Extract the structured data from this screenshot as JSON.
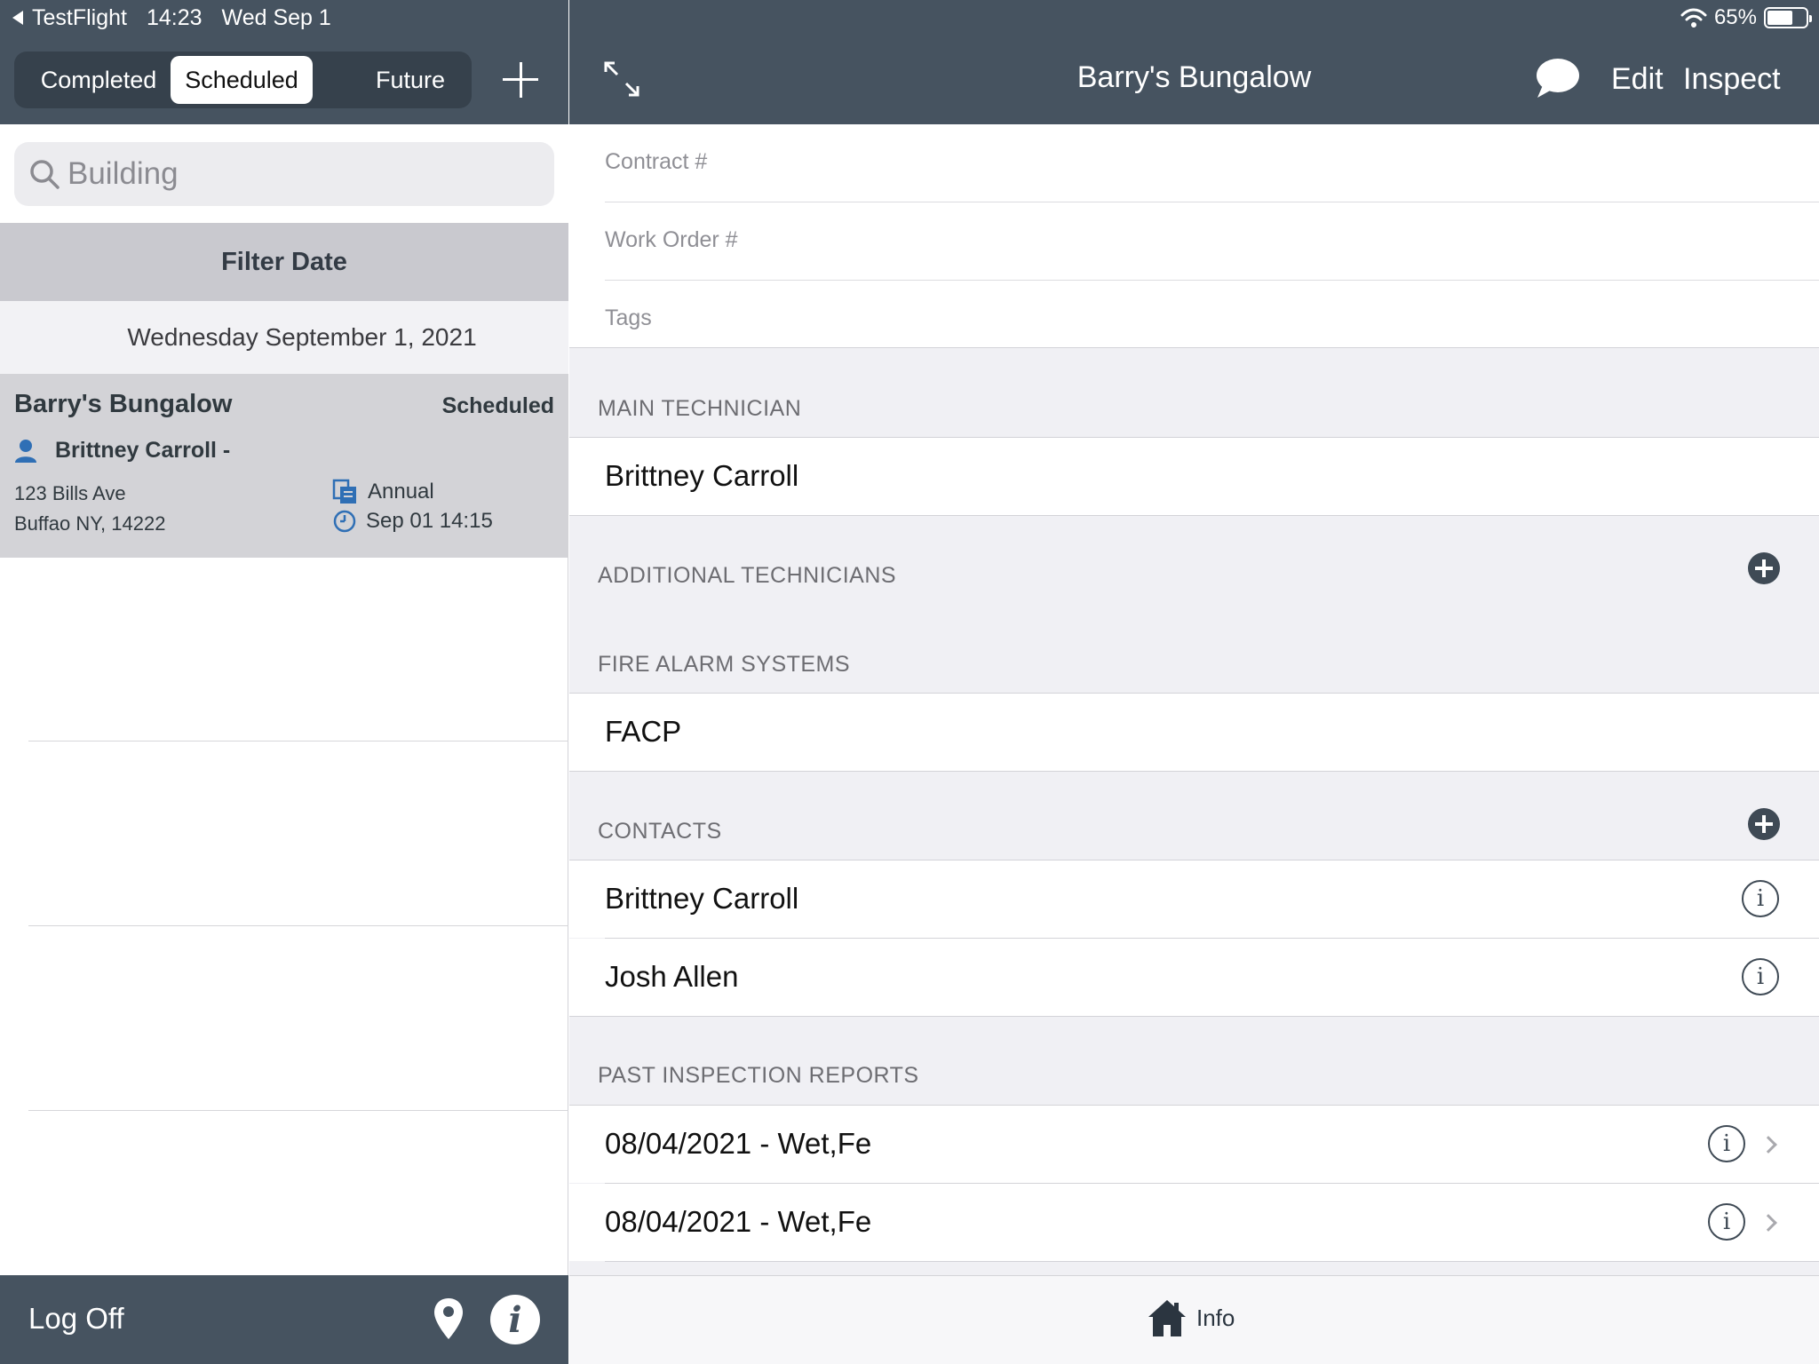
{
  "status_bar": {
    "back_app": "TestFlight",
    "time": "14:23",
    "date": "Wed Sep 1",
    "battery": "65%"
  },
  "left": {
    "segments": [
      "Completed",
      "Scheduled",
      "Future"
    ],
    "active_segment": "Scheduled",
    "search": {
      "placeholder": "Building",
      "value": ""
    },
    "filter_label": "Filter Date",
    "date_heading": "Wednesday September 1, 2021",
    "job": {
      "name": "Barry's Bungalow",
      "status": "Scheduled",
      "technician": "Brittney Carroll -",
      "address_line1": "123 Bills Ave",
      "address_line2": "Buffao NY, 14222",
      "frequency": "Annual",
      "scheduled": "Sep 01 14:15"
    },
    "footer": {
      "log_off": "Log Off"
    }
  },
  "right": {
    "title": "Barry's Bungalow",
    "edit": "Edit",
    "inspect": "Inspect",
    "fields": {
      "contract_placeholder": "Contract #",
      "work_order_placeholder": "Work Order #",
      "tags_placeholder": "Tags"
    },
    "main_technician": {
      "label": "MAIN TECHNICIAN",
      "name": "Brittney Carroll"
    },
    "additional_technicians": {
      "label": "ADDITIONAL TECHNICIANS"
    },
    "fire_alarm_systems": {
      "label": "FIRE ALARM SYSTEMS",
      "items": [
        "FACP"
      ]
    },
    "contacts": {
      "label": "CONTACTS",
      "items": [
        "Brittney Carroll",
        "Josh Allen"
      ]
    },
    "past_reports": {
      "label": "PAST INSPECTION REPORTS",
      "items": [
        "08/04/2021 - Wet,Fe",
        "08/04/2021 - Wet,Fe"
      ]
    },
    "tab_bar": {
      "info": "Info"
    }
  },
  "colors": {
    "header_bg": "#465360",
    "segment_bg": "#36414c",
    "job_card_bg": "#d3d3d7",
    "filter_bg": "#c9c9cf",
    "accent_blue": "#2f6fb5",
    "group_bg": "#f0f0f4"
  },
  "icons": {
    "back": "back-arrow-icon",
    "add": "plus-icon",
    "search": "search-icon",
    "person": "person-icon",
    "document": "document-icon",
    "clock": "clock-icon",
    "location": "location-pin-icon",
    "info": "info-icon",
    "expand": "expand-icon",
    "chat": "chat-bubble-icon",
    "home": "home-icon",
    "wifi": "wifi-icon",
    "battery": "battery-icon"
  }
}
